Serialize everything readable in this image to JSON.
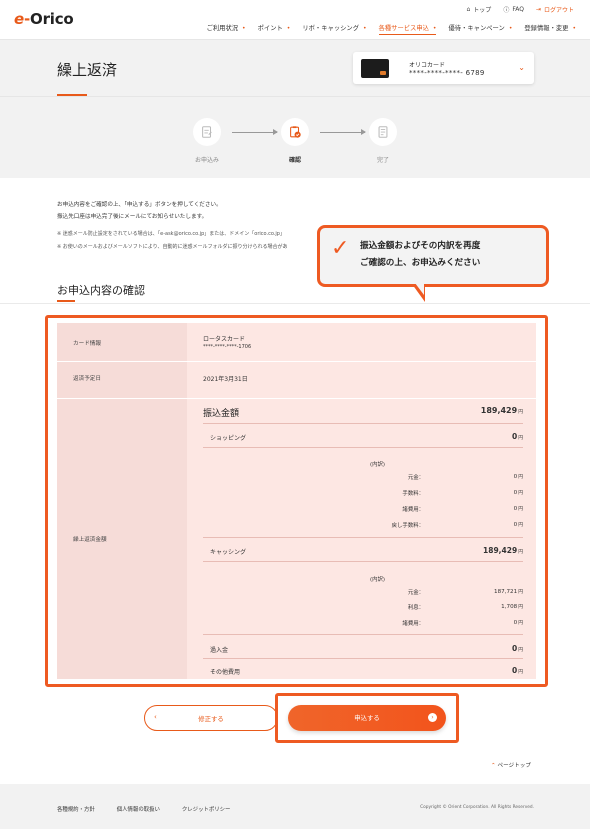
{
  "header": {
    "logo_e": "e",
    "logo_dash": "-",
    "logo_text": "Orico",
    "util": {
      "top": "トップ",
      "faq": "FAQ",
      "logout": "ログアウト"
    },
    "nav": [
      "ご利用状況",
      "ポイント",
      "リボ・キャッシング",
      "各種サービス申込",
      "優待・キャンペーン",
      "登録情報・変更"
    ],
    "nav_active_index": 3
  },
  "title": {
    "text": "繰上返済"
  },
  "card_selector": {
    "name": "オリコカード",
    "number": "****-****-****- 6789"
  },
  "steps": [
    {
      "label": "お申込み",
      "active": false
    },
    {
      "label": "確認",
      "active": true
    },
    {
      "label": "完了",
      "active": false
    }
  ],
  "intro": {
    "line1": "お申込内容をご確認の上、「申込する」ボタンを押してください。",
    "line2": "振込先口座は申込完了後にメールにてお知らせいたします。",
    "note1": "※ 迷惑メール防止設定をされている場合は、「e-ask@orico.co.jp」または、ドメイン「orico.co.jp」",
    "note2": "※ お使いのメールおよびメールソフトにより、自動的に迷惑メールフォルダに振り分けられる場合があ"
  },
  "callout": {
    "line1": "振込金額およびその内訳を再度",
    "line2": "ご確認の上、お申込みください"
  },
  "section_title": "お申込内容の確認",
  "table": {
    "card_info_label": "カード情報",
    "card_name": "ロータスカード",
    "card_number": "****-****-****-1706",
    "date_label": "返済予定日",
    "date_value": "2021年3月31日",
    "amount_label": "繰上返済金額",
    "transfer_label": "振込金額",
    "transfer_value": "189,429",
    "unit": "円",
    "shopping_label": "ショッピング",
    "shopping_value": "0",
    "breakdown_label": "(内訳)",
    "shopping_breakdown": [
      {
        "label": "元金：",
        "value": "0"
      },
      {
        "label": "手数料：",
        "value": "0"
      },
      {
        "label": "諸費用：",
        "value": "0"
      },
      {
        "label": "戻し手数料：",
        "value": "0"
      }
    ],
    "cashing_label": "キャッシング",
    "cashing_value": "189,429",
    "cashing_breakdown": [
      {
        "label": "元金：",
        "value": "187,721"
      },
      {
        "label": "利息：",
        "value": "1,708"
      },
      {
        "label": "諸費用：",
        "value": "0"
      }
    ],
    "overpay_label": "過入金",
    "overpay_value": "0",
    "other_label": "その他費用",
    "other_value": "0"
  },
  "buttons": {
    "fix": "修正する",
    "apply": "申込する"
  },
  "pagetop": "ページトップ",
  "footer": {
    "links": [
      "各種規約・方針",
      "個人情報の取扱い",
      "クレジットポリシー"
    ],
    "copyright": "Copyright © Orient Corporation. All Rights Reserved."
  },
  "colors": {
    "accent": "#e85a1a",
    "highlight": "#ee5a22",
    "table_bg": "#fde7e3"
  }
}
